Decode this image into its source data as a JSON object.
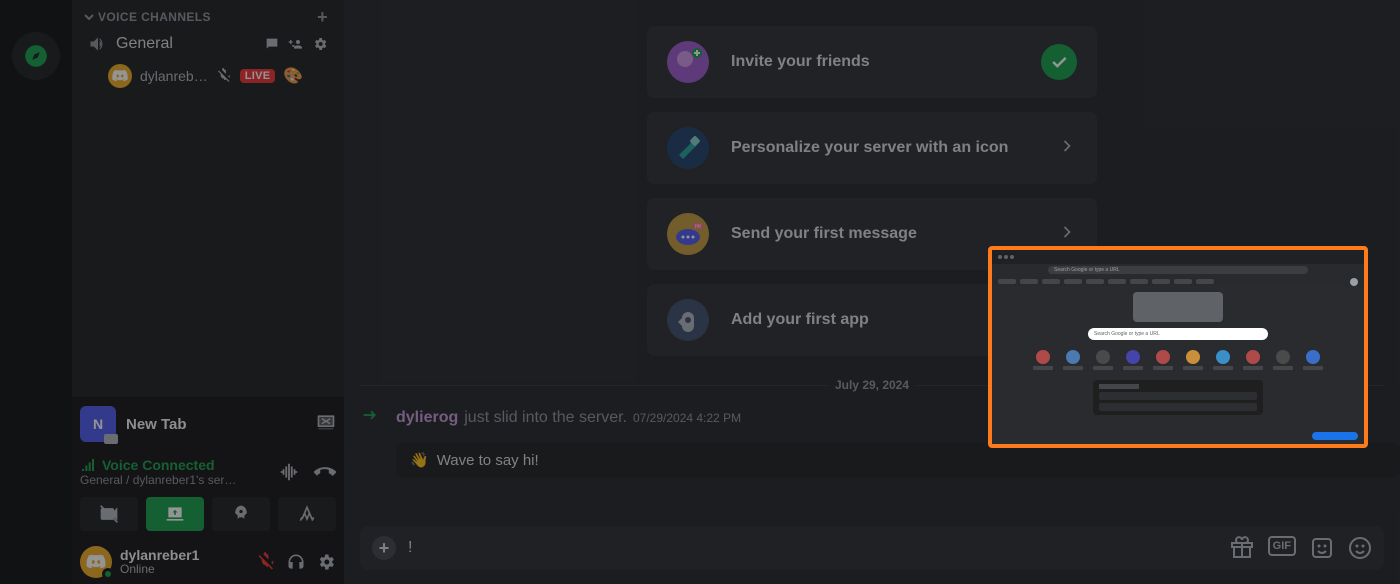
{
  "sidebar": {
    "section_label": "VOICE CHANNELS",
    "voice_channel_name": "General",
    "vc_user_name": "dylanreb…",
    "live_badge": "LIVE"
  },
  "tab_preview": {
    "name": "New Tab"
  },
  "voice": {
    "status": "Voice Connected",
    "subtitle": "General / dylanreber1's ser…"
  },
  "user": {
    "name": "dylanreber1",
    "status": "Online"
  },
  "onboard": {
    "invite": "Invite your friends",
    "personalize": "Personalize your server with an icon",
    "first_msg": "Send your first message",
    "first_app": "Add your first app"
  },
  "divider_date": "July 29, 2024",
  "sysmsg": {
    "author": "dylierog",
    "text": "just slid into the server.",
    "timestamp": "07/29/2024 4:22 PM"
  },
  "wave_label": "Wave to say hi!",
  "composer": {
    "value": "!"
  },
  "share_preview": {
    "omnibox_hint": "Search Google or type a URL",
    "search_hint": "Search Google or type a URL"
  }
}
